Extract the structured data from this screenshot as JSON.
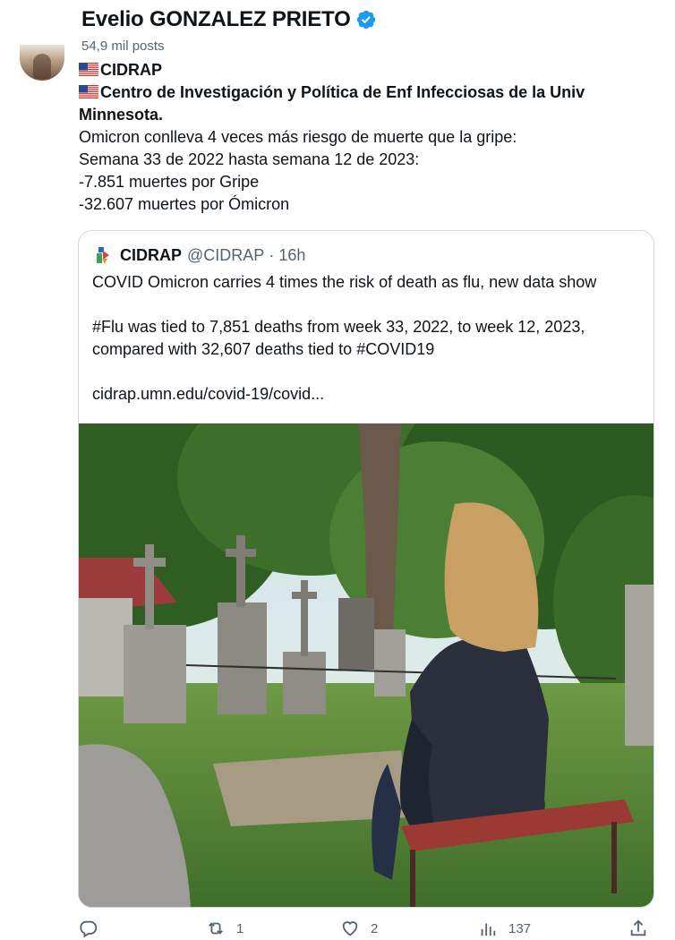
{
  "header": {
    "display_name": "Evelio GONZALEZ PRIETO",
    "post_count": "54,9 mil posts"
  },
  "tweet": {
    "lines": [
      {
        "text": "CIDRAP",
        "bold": true,
        "flag": true
      },
      {
        "text": "Centro de Investigación y Política de Enf Infecciosas de la Univ",
        "bold": true,
        "flag": true
      },
      {
        "text": "Minnesota.",
        "bold": true,
        "flag": false
      },
      {
        "text": "Omicron conlleva 4 veces más riesgo de muerte que la gripe:",
        "bold": false,
        "flag": false
      },
      {
        "text": "Semana 33 de 2022 hasta semana 12 de 2023:",
        "bold": false,
        "flag": false
      },
      {
        "text": "-7.851 muertes por Gripe",
        "bold": false,
        "flag": false
      },
      {
        "text": "-32.607 muertes por Ómicron",
        "bold": false,
        "flag": false
      }
    ]
  },
  "quoted_tweet": {
    "author": "CIDRAP",
    "handle": "@CIDRAP",
    "time": "16h",
    "paragraphs": [
      "COVID Omicron carries 4 times the risk of death as flu, new data show",
      "",
      "#Flu was tied to 7,851 deaths from week 33, 2022, to week 12, 2023,",
      "compared with 32,607 deaths tied to #COVID19",
      "",
      "cidrap.umn.edu/covid-19/covid..."
    ]
  },
  "actions": {
    "reply_count": "",
    "repost_count": "1",
    "like_count": "2",
    "views_count": "137"
  },
  "colors": {
    "verified": "#1d9bf0",
    "secondary_text": "#536471",
    "border": "#cfd9de"
  }
}
